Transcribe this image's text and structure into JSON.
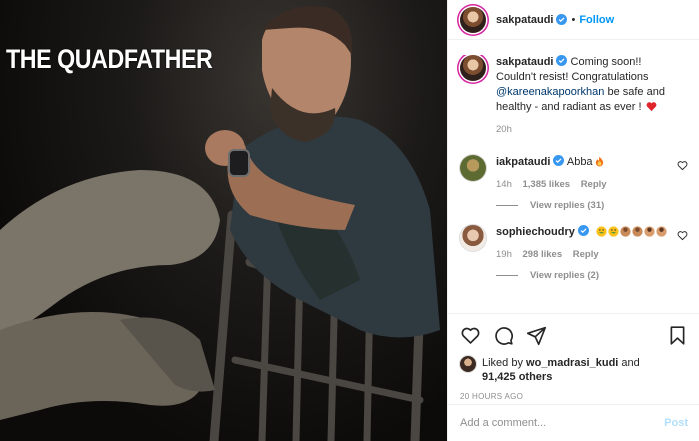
{
  "photo": {
    "overlay_text": "THE QUADFATHER",
    "alt_icon": "portrait-photo"
  },
  "post": {
    "author": "sakpataudi",
    "follow_label": "Follow",
    "separator": "•",
    "caption_prefix": "Coming soon!! Couldn't resist! Congratulations ",
    "caption_mention": "@kareenakapoorkhan",
    "caption_suffix": " be safe and healthy - and radiant as ever ! ",
    "caption_age": "20h",
    "likes_prefix": "Liked by ",
    "likes_user": "wo_madrasi_kudi",
    "likes_mid": " and",
    "likes_count": "91,425 others",
    "timestamp": "20 HOURS AGO"
  },
  "comments": [
    {
      "user": "iakpataudi",
      "text": "Abba",
      "age": "14h",
      "likes": "1,385 likes",
      "reply_label": "Reply",
      "view_replies": "View replies (31)"
    },
    {
      "user": "sophiechoudry",
      "text": "",
      "age": "19h",
      "likes": "298 likes",
      "reply_label": "Reply",
      "view_replies": "View replies (2)"
    }
  ],
  "composer": {
    "placeholder": "Add a comment...",
    "post_label": "Post"
  },
  "colors": {
    "accent": "#0095f6",
    "verified": "#3897f0",
    "heart": "#ed4956",
    "muted": "#8e8e8e"
  },
  "icons": [
    "verified-icon",
    "heart-icon",
    "comment-icon",
    "share-icon",
    "bookmark-icon",
    "fire-emoji-icon",
    "red-heart-emoji-icon",
    "grinning-emoji-icon"
  ]
}
